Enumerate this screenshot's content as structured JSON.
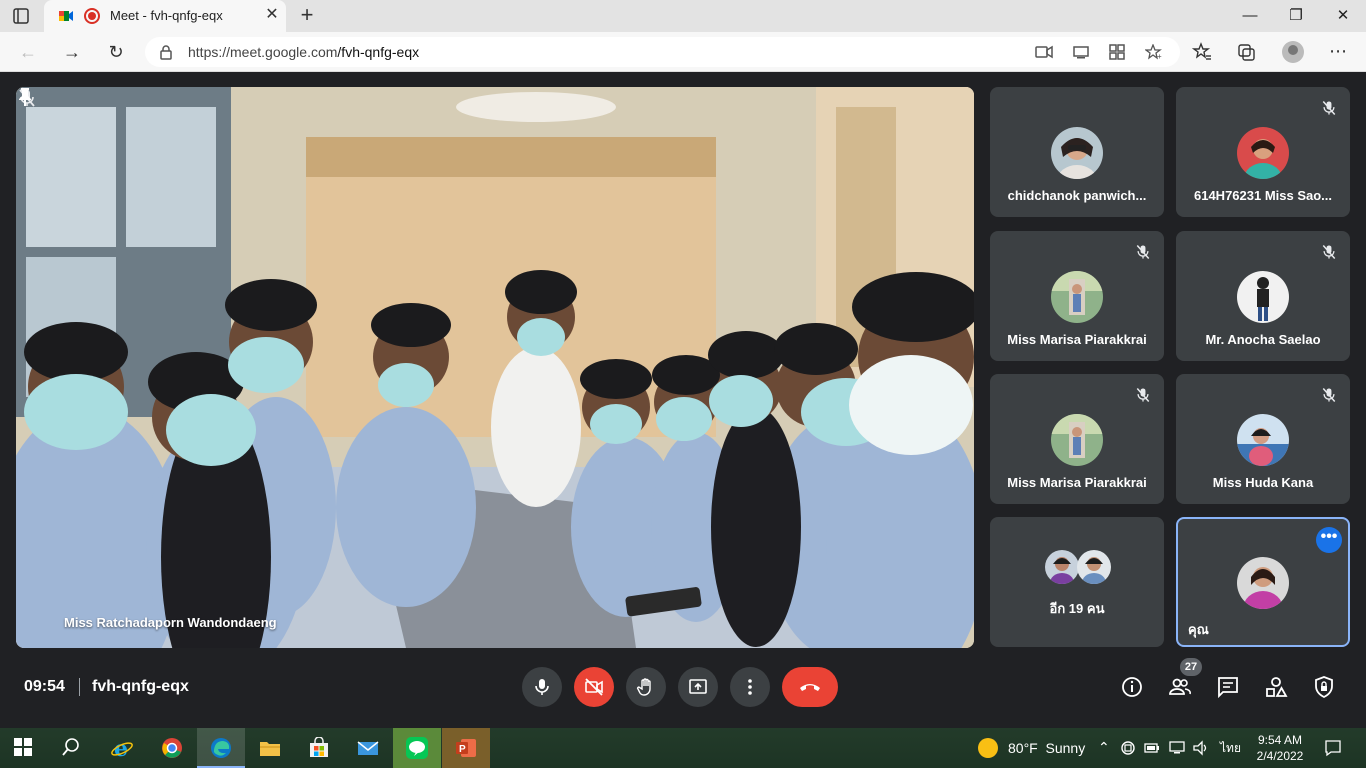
{
  "browser": {
    "tab_title": "Meet - fvh-qnfg-eqx",
    "url_host": "https://meet.google.com",
    "url_path": "/fvh-qnfg-eqx"
  },
  "main_speaker": {
    "name": "Miss Ratchadaporn Wandondaeng"
  },
  "participants": [
    {
      "name": "chidchanok panwich..."
    },
    {
      "name": "614H76231 Miss Sao..."
    },
    {
      "name": "Miss Marisa Piarakkrai"
    },
    {
      "name": "Mr. Anocha Saelao"
    },
    {
      "name": "Miss Marisa Piarakkrai"
    },
    {
      "name": "Miss Huda Kana"
    }
  ],
  "others_tile": {
    "label": "อีก 19 คน"
  },
  "self_tile": {
    "label": "คุณ",
    "more": "•••"
  },
  "meeting": {
    "time": "09:54",
    "code": "fvh-qnfg-eqx",
    "participant_count": "27"
  },
  "taskbar": {
    "weather_temp": "80°F",
    "weather_desc": "Sunny",
    "language": "ไทย",
    "time": "9:54 AM",
    "date": "2/4/2022"
  },
  "colors": {
    "meet_bg": "#202124",
    "tile_bg": "#3c4043",
    "danger": "#ea4335",
    "accent": "#1a73e8"
  }
}
